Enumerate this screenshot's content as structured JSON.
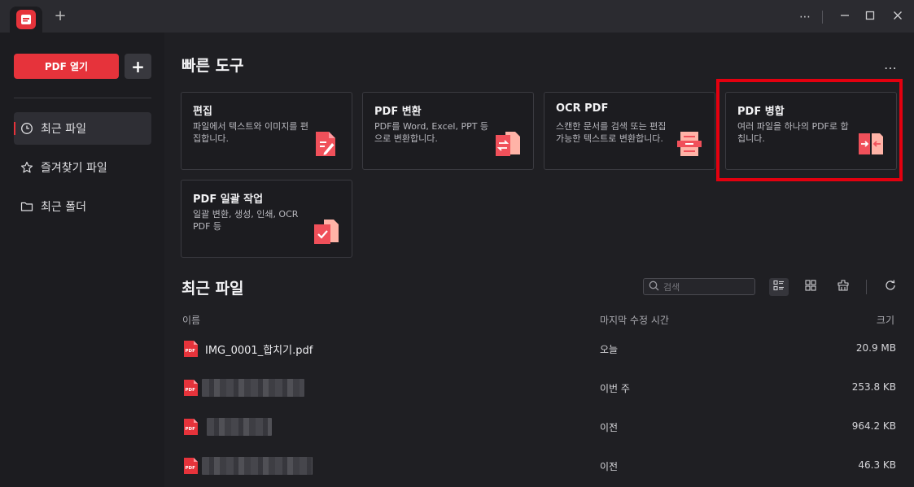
{
  "titlebar": {
    "new_tab": "+",
    "more": "⋯",
    "minimize": "—",
    "maximize": "☐",
    "close": "✕"
  },
  "sidebar": {
    "open_pdf_label": "PDF 열기",
    "add_label": "+",
    "items": [
      {
        "label": "최근 파일",
        "icon": "clock-icon",
        "active": true
      },
      {
        "label": "즐겨찾기 파일",
        "icon": "star-icon",
        "active": false
      },
      {
        "label": "최근 폴더",
        "icon": "folder-icon",
        "active": false
      }
    ]
  },
  "quick_tools": {
    "title": "빠른 도구",
    "more": "⋯",
    "cards": [
      {
        "title": "편집",
        "desc": "파일에서 텍스트와 이미지를 편집합니다.",
        "icon": "edit-doc-icon"
      },
      {
        "title": "PDF 변환",
        "desc": "PDF를 Word, Excel, PPT 등으로 변환합니다.",
        "icon": "convert-icon"
      },
      {
        "title": "OCR PDF",
        "desc": "스캔한 문서를 검색 또는 편집 가능한 텍스트로 변환합니다.",
        "icon": "ocr-icon"
      },
      {
        "title": "PDF 병합",
        "desc": "여러 파일을 하나의 PDF로 합칩니다.",
        "icon": "merge-icon"
      },
      {
        "title": "PDF 일괄 작업",
        "desc": "일괄 변환, 생성, 인쇄, OCR PDF 등",
        "icon": "batch-icon"
      }
    ]
  },
  "recent": {
    "title": "최근 파일",
    "search_placeholder": "검색",
    "columns": {
      "name": "이름",
      "modified": "마지막 수정 시간",
      "size": "크기"
    },
    "rows": [
      {
        "name": "IMG_0001_합치기.pdf",
        "modified": "오늘",
        "size": "20.9 MB",
        "redacted": false
      },
      {
        "name": "",
        "modified": "이번 주",
        "size": "253.8 KB",
        "redacted": true
      },
      {
        "name": "",
        "modified": "이전",
        "size": "964.2 KB",
        "redacted": true
      },
      {
        "name": "",
        "modified": "이전",
        "size": "46.3 KB",
        "redacted": true
      }
    ]
  },
  "colors": {
    "accent": "#e6333b",
    "highlight": "#e3000f",
    "background": "#1f1f23"
  }
}
